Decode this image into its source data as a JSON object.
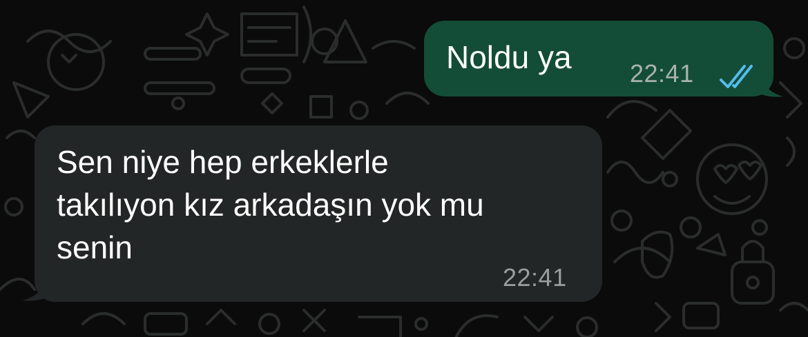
{
  "messages": [
    {
      "direction": "outgoing",
      "text_lines": [
        "Noldu ya"
      ],
      "time": "22:41",
      "status": "read",
      "status_icon": "double-check-icon",
      "bubble_color": "#144d37",
      "tick_color": "#53bdeb"
    },
    {
      "direction": "incoming",
      "text_lines": [
        "Sen niye hep erkeklerle",
        "takılıyon kız arkadaşın yok mu",
        "senin"
      ],
      "time": "22:41",
      "bubble_color": "#232626"
    }
  ],
  "wallpaper": {
    "background_color": "#0b0b0b",
    "doodle_color": "#2b2d2d"
  }
}
